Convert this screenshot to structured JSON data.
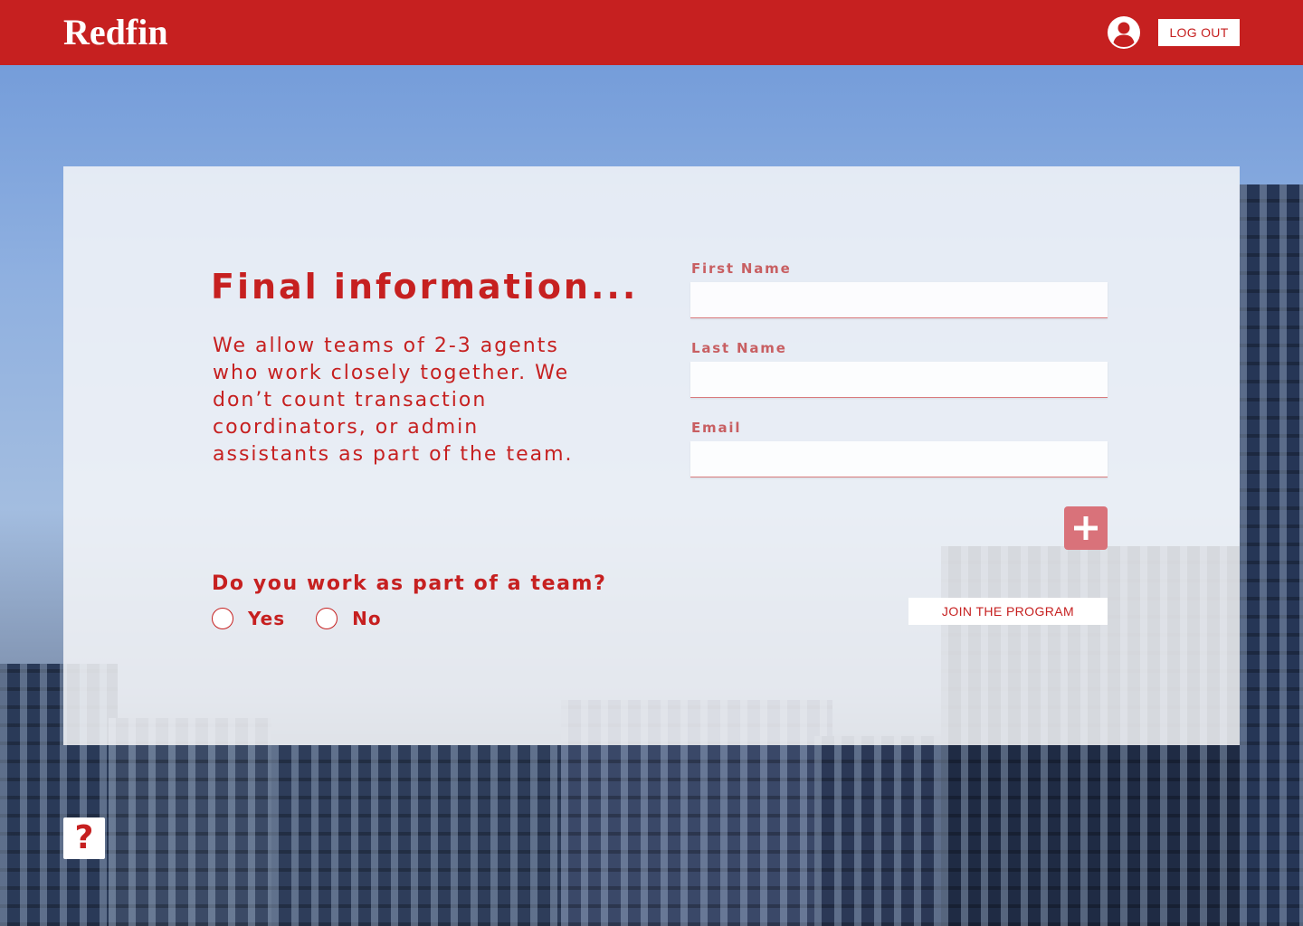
{
  "header": {
    "logo_text": "Redfin",
    "logout_label": "LOG OUT",
    "avatar_icon": "user-circle-icon"
  },
  "info": {
    "title": "Final information...",
    "description": "We allow teams of 2-3 agents who work closely together. We don’t count transaction coordinators, or admin assistants as part of the team.",
    "team_question": "Do you work as part of a team?",
    "options": [
      {
        "label": "Yes",
        "selected": false
      },
      {
        "label": "No",
        "selected": false
      }
    ]
  },
  "form": {
    "first_name_label": "First Name",
    "first_name_value": "",
    "last_name_label": "Last Name",
    "last_name_value": "",
    "email_label": "Email",
    "email_value": "",
    "add_icon": "plus-icon",
    "join_label": "JOIN THE PROGRAM"
  },
  "help": {
    "label": "?"
  },
  "colors": {
    "brand": "#c62020",
    "field_label": "#c85f62",
    "add_button": "#d9727a"
  }
}
